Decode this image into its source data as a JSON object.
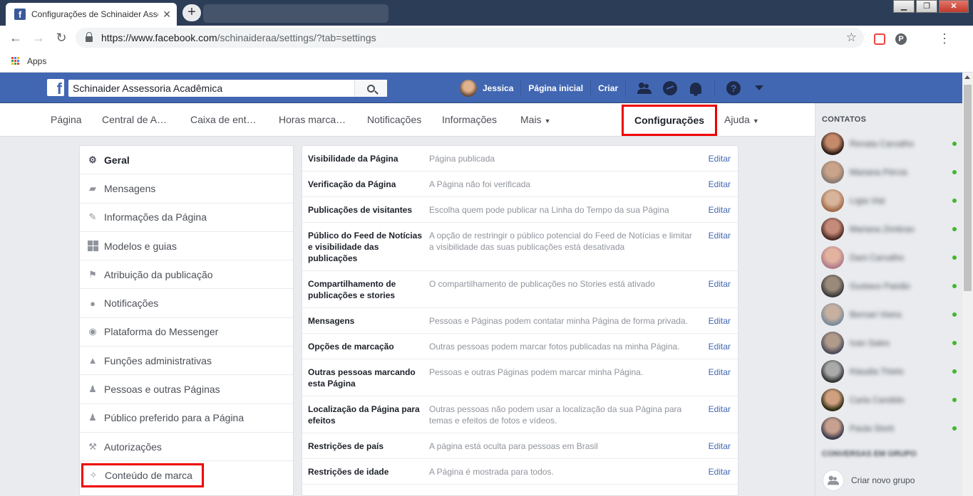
{
  "browser": {
    "tab_title": "Configurações de Schinaider Assessoria Acadêmica",
    "url_host": "https://www.facebook.com",
    "url_path": "/schinaideraa/settings/?tab=settings",
    "bookmark_apps": "Apps"
  },
  "fbbar": {
    "search_value": "Schinaider Assessoria Acadêmica",
    "user_name": "Jessica",
    "home_label": "Página inicial",
    "create_label": "Criar"
  },
  "page_tabs": {
    "pagina": "Página",
    "central": "Central de A…",
    "caixa": "Caixa de ent…",
    "horas": "Horas marca…",
    "notificacoes": "Notificações",
    "informacoes": "Informações",
    "mais": "Mais",
    "configuracoes": "Configurações",
    "ajuda": "Ajuda"
  },
  "left_nav": [
    {
      "label": "Geral",
      "icon": "gear-icon"
    },
    {
      "label": "Mensagens",
      "icon": "messages-icon"
    },
    {
      "label": "Informações da Página",
      "icon": "pencil-icon"
    },
    {
      "label": "Modelos e guias",
      "icon": "grid-icon"
    },
    {
      "label": "Atribuição da publicação",
      "icon": "flag-icon"
    },
    {
      "label": "Notificações",
      "icon": "globe-icon"
    },
    {
      "label": "Plataforma do Messenger",
      "icon": "messenger-icon"
    },
    {
      "label": "Funções administrativas",
      "icon": "person-icon"
    },
    {
      "label": "Pessoas e outras Páginas",
      "icon": "person-star-icon"
    },
    {
      "label": "Público preferido para a Página",
      "icon": "person-star-icon"
    },
    {
      "label": "Autorizações",
      "icon": "wrench-icon"
    },
    {
      "label": "Conteúdo de marca",
      "icon": "handshake-icon"
    }
  ],
  "settings": {
    "edit_label": "Editar",
    "rows": [
      {
        "label": "Visibilidade da Página",
        "value": "Página publicada"
      },
      {
        "label": "Verificação da Página",
        "value": "A Página não foi verificada"
      },
      {
        "label": "Publicações de visitantes",
        "value": "Escolha quem pode publicar na Linha do Tempo da sua Página"
      },
      {
        "label": "Público do Feed de Notícias e visibilidade das publicações",
        "value": "A opção de restringir o público potencial do Feed de Notícias e limitar a visibilidade das suas publicações está desativada"
      },
      {
        "label": "Compartilhamento de publicações e stories",
        "value": "O compartilhamento de publicações no Stories está ativado"
      },
      {
        "label": "Mensagens",
        "value": "Pessoas e Páginas podem contatar minha Página de forma privada."
      },
      {
        "label": "Opções de marcação",
        "value": "Outras pessoas podem marcar fotos publicadas na minha Página."
      },
      {
        "label": "Outras pessoas marcando esta Página",
        "value": "Pessoas e outras Páginas podem marcar minha Página."
      },
      {
        "label": "Localização da Página para efeitos",
        "value": "Outras pessoas não podem usar a localização da sua Página para temas e efeitos de fotos e vídeos."
      },
      {
        "label": "Restrições de país",
        "value": "A página está oculta para pessoas em Brasil"
      },
      {
        "label": "Restrições de idade",
        "value": "A Página é mostrada para todos."
      }
    ]
  },
  "contacts": {
    "header": "CONTATOS",
    "names": [
      "Renata Carvalho",
      "Mariana Pércia",
      "Lígia Vial",
      "Mariana Zimbrao",
      "Dani Carvalho",
      "Gustavo Paixão",
      "Bernari Vieira",
      "Ivan Sales",
      "Klaudia Thielo",
      "Carla Candido",
      "Paula Storti"
    ],
    "group_header": "CONVERSAS EM GRUPO",
    "new_group": "Criar novo grupo"
  },
  "colors": {
    "fb_blue": "#4267b2",
    "highlight_red": "#e00000",
    "online_green": "#42b72a"
  }
}
